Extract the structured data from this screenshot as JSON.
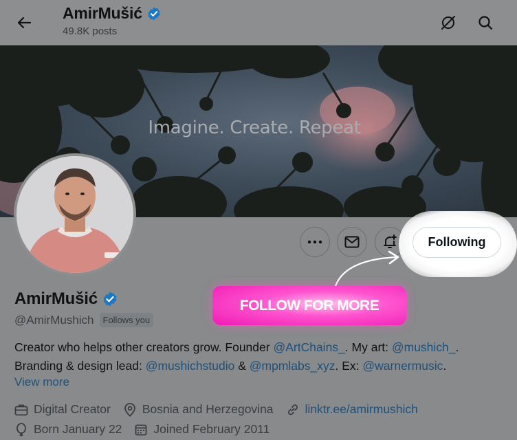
{
  "header": {
    "title": "AmirMušić",
    "posts": "49.8K posts",
    "icons": {
      "back": "arrow-left-icon",
      "grok": "grok-icon",
      "search": "search-icon"
    }
  },
  "banner": {
    "text": "Imagine. Create. Repeat"
  },
  "actions": {
    "more": "more-icon",
    "message": "mail-icon",
    "notify": "bell-plus-icon",
    "following_label": "Following"
  },
  "promo": {
    "label": "FOLLOW FOR MORE"
  },
  "profile": {
    "name": "AmirMušić",
    "handle": "@AmirMushich",
    "follows_you": "Follows you",
    "bio": {
      "t1": "Creator who helps other creators grow. Founder ",
      "l1": "@ArtChains_",
      "t2": ". My art: ",
      "l2": "@mushich_",
      "t3": ".",
      "t4": "Branding & design lead: ",
      "l3": "@mushichstudio",
      "t5": " & ",
      "l4": "@mpmlabs_xyz",
      "t6": ". Ex: ",
      "l5": "@warnermusic",
      "t7": "."
    },
    "view_more": "View more",
    "meta": {
      "category": "Digital Creator",
      "location": "Bosnia and Herzegovina",
      "website": "linktr.ee/amirmushich",
      "born": "Born January 22",
      "joined": "Joined February 2011"
    }
  },
  "colors": {
    "link": "#1d4f7a",
    "verified": "#1d77c2",
    "cta": "#ff3fc6"
  }
}
